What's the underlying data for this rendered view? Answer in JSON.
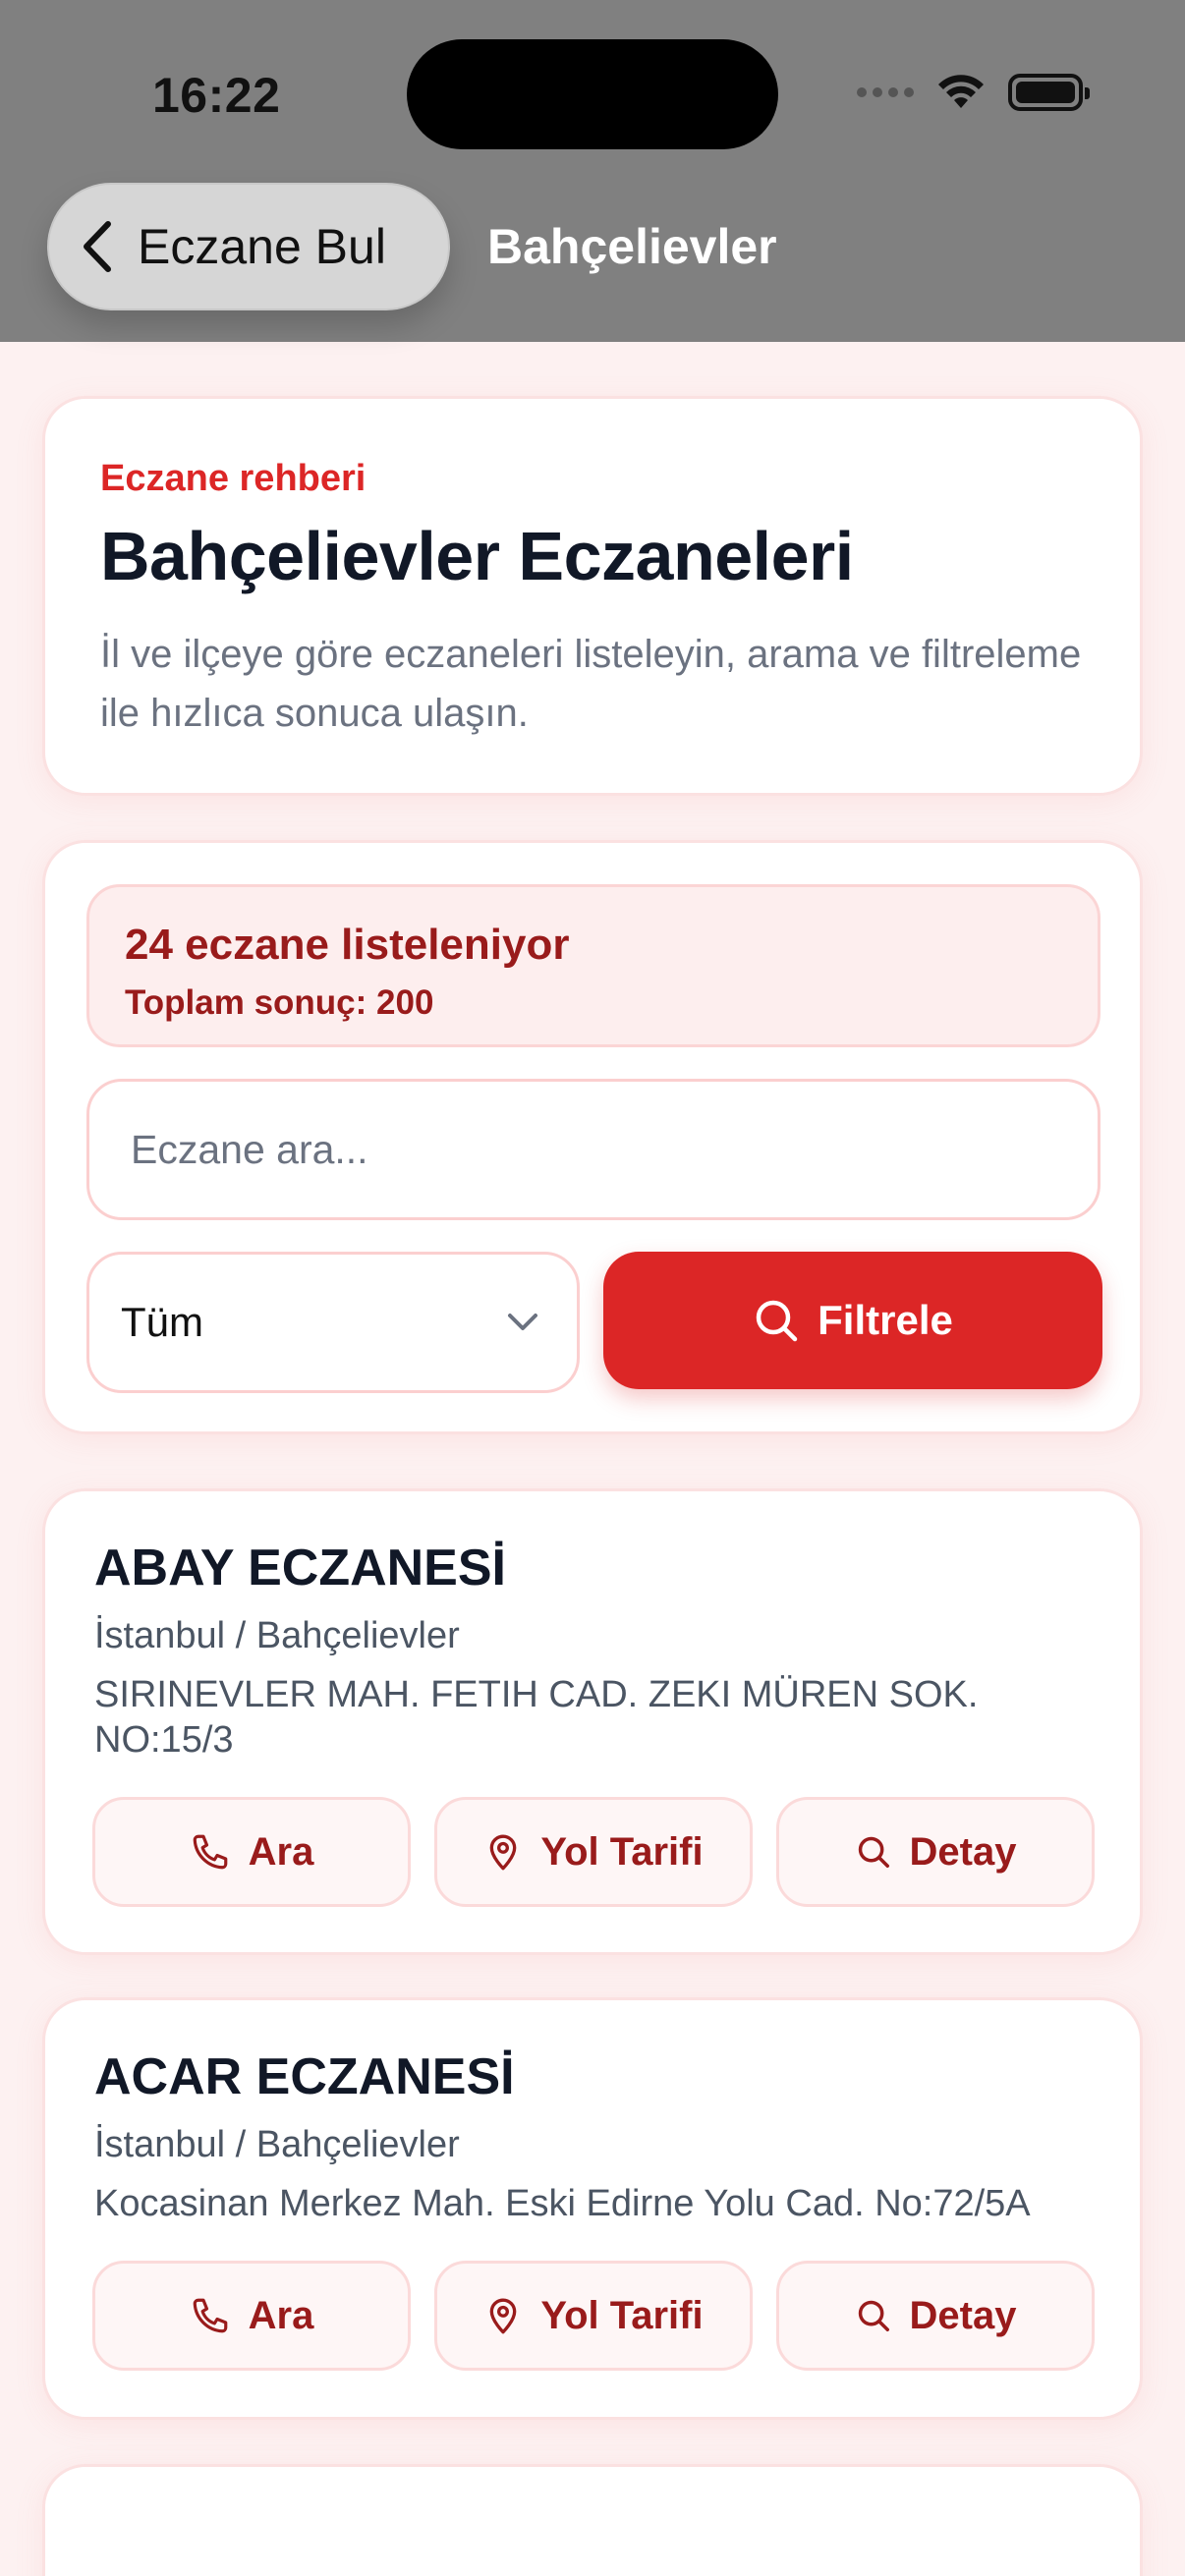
{
  "status_bar": {
    "time": "16:22"
  },
  "nav": {
    "back_label": "Eczane Bul",
    "title": "Bahçelievler"
  },
  "hero": {
    "eyebrow": "Eczane rehberi",
    "title": "Bahçelievler Eczaneleri",
    "description": "İl ve ilçeye göre eczaneleri listeleyin, arama ve filtreleme ile hızlıca sonuca ulaşın."
  },
  "filters": {
    "count_text": "24 eczane listeleniyor",
    "total_text": "Toplam sonuç: 200",
    "search_placeholder": "Eczane ara...",
    "select_value": "Tüm",
    "filter_button": "Filtrele"
  },
  "pharmacies": [
    {
      "name": "ABAY ECZANESİ",
      "location": "İstanbul / Bahçelievler",
      "address": "SIRINEVLER MAH. FETIH CAD. ZEKI MÜREN SOK. NO:15/3",
      "actions": {
        "call": "Ara",
        "directions": "Yol Tarifi",
        "detail": "Detay"
      }
    },
    {
      "name": "ACAR ECZANESİ",
      "location": "İstanbul / Bahçelievler",
      "address": "Kocasinan Merkez Mah. Eski Edirne Yolu Cad. No:72/5A",
      "actions": {
        "call": "Ara",
        "directions": "Yol Tarifi",
        "detail": "Detay"
      }
    }
  ],
  "colors": {
    "accent": "#dc2626",
    "accent_dark": "#991b1b",
    "page_bg": "#fdf1f1",
    "nav_bg": "#808080"
  },
  "icons": {
    "back": "chevron-left-icon",
    "search": "search-icon",
    "dropdown": "chevron-down-icon",
    "call": "phone-icon",
    "directions": "map-pin-icon",
    "detail": "search-icon"
  }
}
